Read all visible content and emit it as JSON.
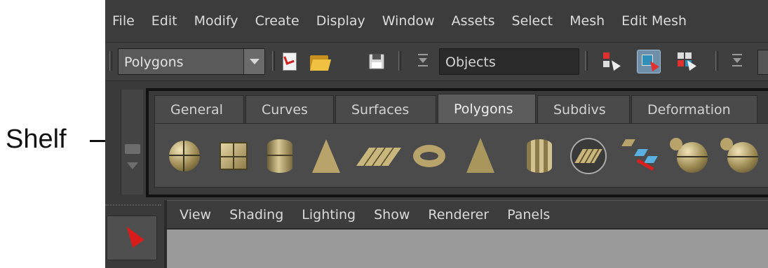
{
  "annotation": {
    "label": "Shelf"
  },
  "menu": [
    "File",
    "Edit",
    "Modify",
    "Create",
    "Display",
    "Window",
    "Assets",
    "Select",
    "Mesh",
    "Edit Mesh"
  ],
  "statusline": {
    "mode": "Polygons",
    "selection_field": "Objects"
  },
  "shelf": {
    "tabs": [
      "General",
      "Curves",
      "Surfaces",
      "Polygons",
      "Subdivs",
      "Deformation"
    ],
    "active_tab": "Polygons",
    "icons": [
      "sphere-icon",
      "cube-icon",
      "cylinder-icon",
      "cone-icon",
      "plane-icon",
      "torus-icon",
      "pyramid-icon",
      "pipe-icon",
      "poly-plane-icon",
      "extract-tiles-icon",
      "combine-sphere-icon",
      "partial-sphere-icon"
    ]
  },
  "viewport_menu": [
    "View",
    "Shading",
    "Lighting",
    "Show",
    "Renderer",
    "Panels"
  ],
  "colors": {
    "ui_bg": "#3a3a3a",
    "accent_select": "#6f8fa8",
    "primitive": "#b8a46a",
    "select_arrow": "#d81c1c"
  }
}
